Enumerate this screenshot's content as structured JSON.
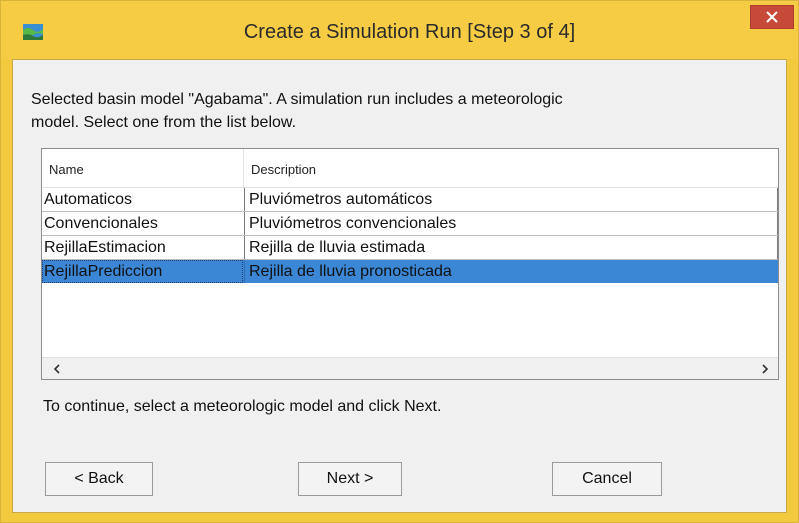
{
  "window": {
    "title": "Create a Simulation Run [Step 3 of 4]",
    "accent_color": "#f5cc44",
    "close_color": "#c7493a",
    "icon": "basin-map-icon"
  },
  "intro": {
    "line1": "Selected basin model \"Agabama\". A simulation run includes a meteorologic",
    "line2": "model. Select one from the list below."
  },
  "table": {
    "columns": [
      "Name",
      "Description"
    ],
    "rows": [
      {
        "name": "Automaticos",
        "description": "Pluviómetros automáticos",
        "selected": false
      },
      {
        "name": "Convencionales",
        "description": "Pluviómetros convencionales",
        "selected": false
      },
      {
        "name": "RejillaEstimacion",
        "description": "Rejilla de lluvia estimada",
        "selected": false
      },
      {
        "name": "RejillaPrediccion",
        "description": "Rejilla de lluvia pronosticada",
        "selected": true
      }
    ],
    "selection_color": "#3b87d6"
  },
  "hint": "To continue, select a meteorologic model and click Next.",
  "buttons": {
    "back": "< Back",
    "next": "Next >",
    "cancel": "Cancel"
  }
}
